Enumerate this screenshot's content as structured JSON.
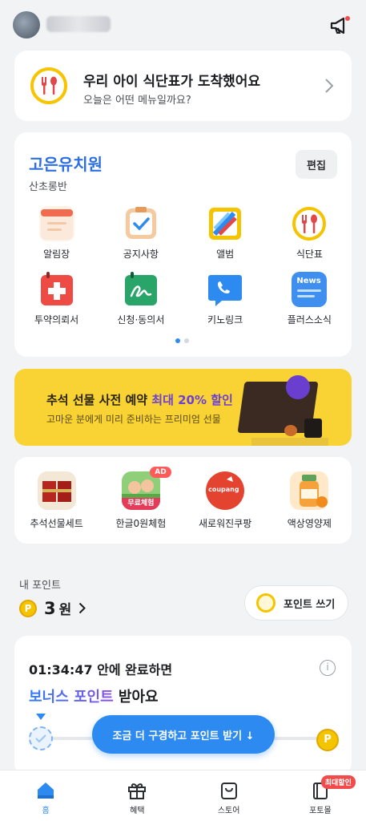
{
  "header": {
    "avatar_icon": "user-avatar",
    "notice_icon": "megaphone-icon"
  },
  "meal_card": {
    "title": "우리 아이 식단표가 도착했어요",
    "subtitle": "오늘은 어떤 메뉴일까요?",
    "icon": "fork-spoon-icon"
  },
  "kindergarten": {
    "name": "고은유치원",
    "class_name": "산초롱반",
    "edit_label": "편집",
    "menu": [
      {
        "label": "알림장",
        "icon": "notebook-icon"
      },
      {
        "label": "공지사항",
        "icon": "clipboard-check-icon"
      },
      {
        "label": "앨범",
        "icon": "album-icon"
      },
      {
        "label": "식단표",
        "icon": "fork-spoon-icon"
      },
      {
        "label": "투약의뢰서",
        "icon": "medical-cross-icon"
      },
      {
        "label": "신청·동의서",
        "icon": "signature-icon"
      },
      {
        "label": "키노링크",
        "icon": "phone-icon"
      },
      {
        "label": "플러스소식",
        "icon": "news-icon"
      }
    ],
    "news_icon_text": "News",
    "page_count": 2,
    "current_page": 1
  },
  "banner": {
    "title_prefix": "추석 선물 사전 예약 ",
    "title_highlight": "최대 20% 할인",
    "subtitle": "고마운 분에게 미리 준비하는 프리미엄 선물",
    "accent_color": "#6d3fd4",
    "background_color": "#f8d333"
  },
  "shop": {
    "items": [
      {
        "label": "추석선물세트"
      },
      {
        "label": "한글0원체험",
        "badge": "AD",
        "tag": "무료체험"
      },
      {
        "label": "새로워진쿠팡",
        "logo_text": "coupang"
      },
      {
        "label": "액상영양제"
      }
    ]
  },
  "points": {
    "label": "내 포인트",
    "coin_symbol": "P",
    "value": "3",
    "unit": "원",
    "use_label": "포인트 쓰기"
  },
  "bonus": {
    "timer_text": "01:34:47 안에 완료하면",
    "highlight": "보너스 포인트",
    "suffix": " 받아요",
    "info_symbol": "i",
    "progress": 0.05,
    "end_symbol": "P",
    "button_label": "조금 더 구경하고 포인트 받기 ↓"
  },
  "tabbar": {
    "tabs": [
      {
        "label": "홈",
        "icon": "home-icon",
        "active": true
      },
      {
        "label": "혜택",
        "icon": "gift-icon",
        "active": false
      },
      {
        "label": "스토어",
        "icon": "shopping-bag-icon",
        "active": false
      },
      {
        "label": "포토몰",
        "icon": "photo-book-icon",
        "active": false,
        "badge": "최대할인"
      }
    ]
  },
  "colors": {
    "primary": "#2d8af0",
    "brand_blue": "#2d6fe0",
    "coin_yellow": "#f5c400",
    "sale_red": "#f24b4b"
  }
}
